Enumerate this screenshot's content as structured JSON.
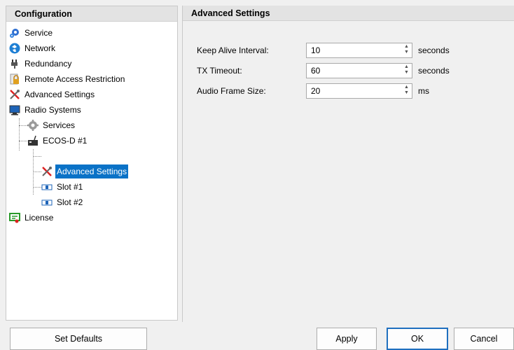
{
  "left_panel": {
    "header": "Configuration",
    "tree": [
      {
        "label": "Service",
        "icon": "service-gear-icon"
      },
      {
        "label": "Network",
        "icon": "network-globe-icon"
      },
      {
        "label": "Redundancy",
        "icon": "redundancy-plug-icon"
      },
      {
        "label": "Remote Access Restriction",
        "icon": "remote-access-icon"
      },
      {
        "label": "Advanced Settings",
        "icon": "advanced-tools-icon"
      },
      {
        "label": "Radio Systems",
        "icon": "radio-systems-monitor-icon"
      },
      {
        "label": "Services",
        "icon": "services-gear-icon"
      },
      {
        "label": "ECOS-D #1",
        "icon": "ecos-device-icon"
      },
      {
        "label": "Advanced Settings",
        "icon": "advanced-tools-icon",
        "selected": true
      },
      {
        "label": "Slot #1",
        "icon": "slot-icon"
      },
      {
        "label": "Slot #2",
        "icon": "slot-icon"
      },
      {
        "label": "License",
        "icon": "license-icon"
      }
    ]
  },
  "right_panel": {
    "header": "Advanced Settings",
    "fields": [
      {
        "label": "Keep Alive Interval:",
        "value": "10",
        "unit": "seconds"
      },
      {
        "label": "TX Timeout:",
        "value": "60",
        "unit": "seconds"
      },
      {
        "label": "Audio Frame Size:",
        "value": "20",
        "unit": "ms"
      }
    ]
  },
  "buttons": {
    "set_defaults": "Set Defaults",
    "apply": "Apply",
    "ok": "OK",
    "cancel": "Cancel"
  },
  "colors": {
    "selection": "#0a72c7",
    "header_bg": "#e3e3e3",
    "panel_bg": "#f0f0f0"
  }
}
